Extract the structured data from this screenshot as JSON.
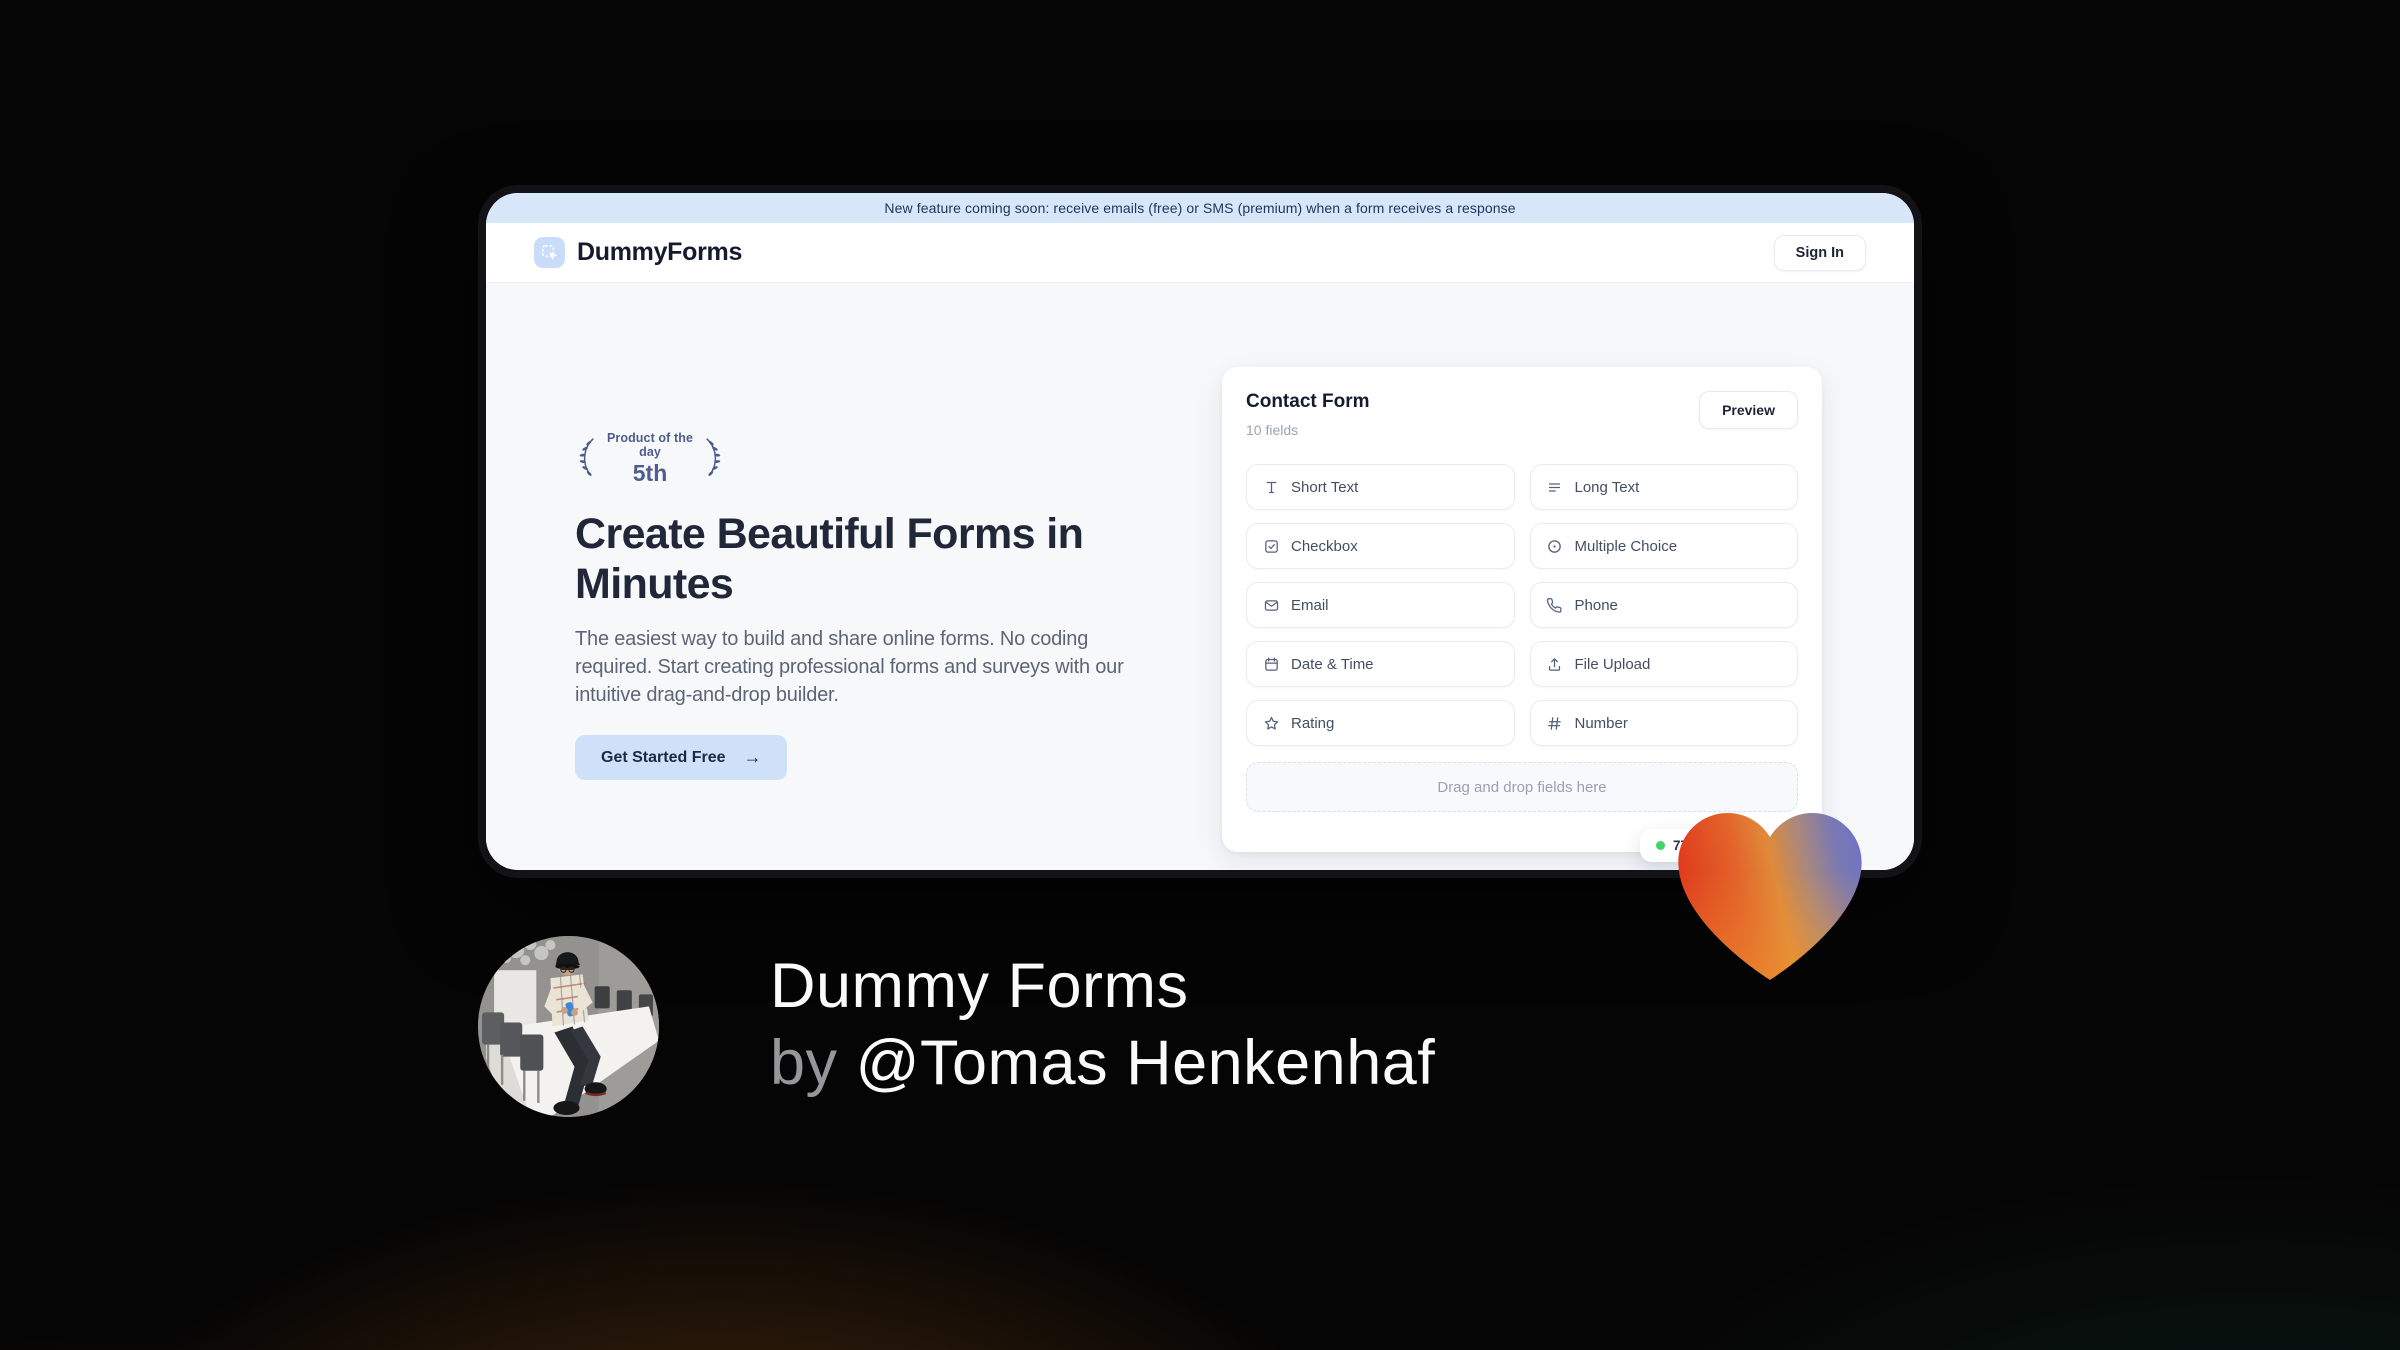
{
  "banner": {
    "text": "New feature coming soon: receive emails (free) or SMS (premium) when a form receives a response"
  },
  "header": {
    "brand": "DummyForms",
    "sign_in_label": "Sign In"
  },
  "hero": {
    "badge": {
      "line1": "Product of the day",
      "line2": "5th"
    },
    "title": "Create Beautiful Forms in Minutes",
    "description": "The easiest way to build and share online forms. No coding required. Start creating professional forms and surveys with our intuitive drag-and-drop builder.",
    "cta_label": "Get Started Free",
    "cta_arrow": "→"
  },
  "form_builder": {
    "title": "Contact Form",
    "subtitle": "10 fields",
    "preview_label": "Preview",
    "fields": [
      {
        "label": "Short Text",
        "icon": "text-icon"
      },
      {
        "label": "Long Text",
        "icon": "lines-icon"
      },
      {
        "label": "Checkbox",
        "icon": "checkbox-icon"
      },
      {
        "label": "Multiple Choice",
        "icon": "radio-icon"
      },
      {
        "label": "Email",
        "icon": "envelope-icon"
      },
      {
        "label": "Phone",
        "icon": "phone-icon"
      },
      {
        "label": "Date & Time",
        "icon": "calendar-icon"
      },
      {
        "label": "File Upload",
        "icon": "upload-icon"
      },
      {
        "label": "Rating",
        "icon": "star-icon"
      },
      {
        "label": "Number",
        "icon": "hash-icon"
      }
    ],
    "dropzone_text": "Drag and drop fields here",
    "responses_badge": {
      "text": "77",
      "dot_color": "#3fd463"
    }
  },
  "attribution": {
    "title": "Dummy Forms",
    "byline_prefix": "by",
    "author": "@Tomas Henkenhaf"
  },
  "colors": {
    "banner_bg": "#d8e6fa",
    "accent_blue": "#cfe1f9",
    "navy_text": "#202739",
    "badge_slate": "#4d5d8d",
    "status_green": "#3fd463",
    "heart_gradient": [
      "#df3a1d",
      "#e2622a",
      "#e08a3a",
      "#7b79b2",
      "#6f73c5"
    ],
    "page_bg": "#060505"
  }
}
